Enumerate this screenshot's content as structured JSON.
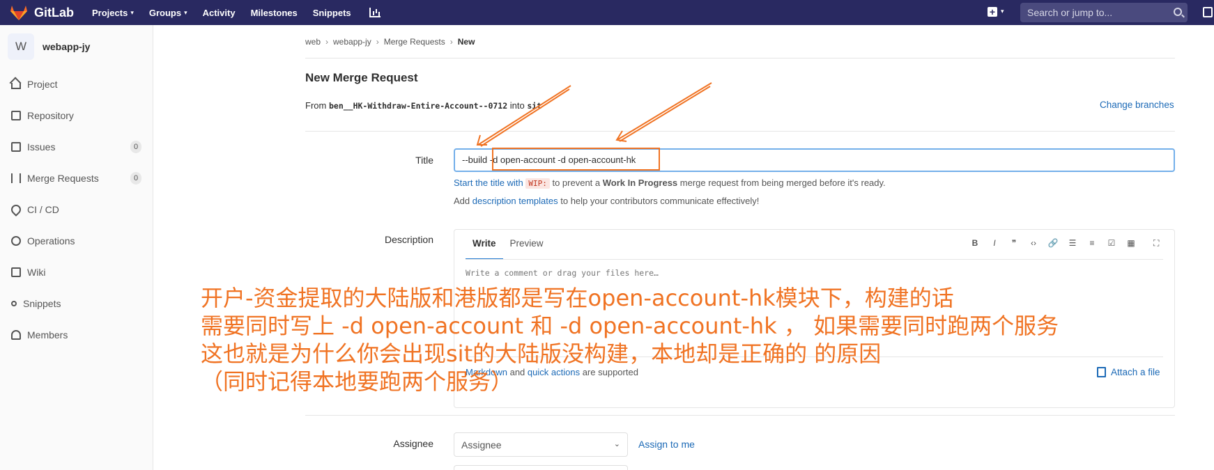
{
  "topbar": {
    "brand": "GitLab",
    "nav": [
      {
        "label": "Projects",
        "caret": "▾"
      },
      {
        "label": "Groups",
        "caret": "▾"
      },
      {
        "label": "Activity",
        "caret": ""
      },
      {
        "label": "Milestones",
        "caret": ""
      },
      {
        "label": "Snippets",
        "caret": ""
      }
    ],
    "search_placeholder": "Search or jump to...",
    "brand_color": "#292961",
    "logo_color": "#fc6d26"
  },
  "sidebar": {
    "avatar_letter": "W",
    "project_name": "webapp-jy",
    "items": [
      {
        "label": "Project",
        "icon": "home-icon"
      },
      {
        "label": "Repository",
        "icon": "book-icon"
      },
      {
        "label": "Issues",
        "icon": "issues-icon",
        "count": "0"
      },
      {
        "label": "Merge Requests",
        "icon": "git-merge-icon",
        "count": "0"
      },
      {
        "label": "CI / CD",
        "icon": "rocket-icon"
      },
      {
        "label": "Operations",
        "icon": "cloud-gear-icon"
      },
      {
        "label": "Wiki",
        "icon": "book-icon"
      },
      {
        "label": "Snippets",
        "icon": "scissors-icon"
      },
      {
        "label": "Members",
        "icon": "users-icon"
      }
    ]
  },
  "breadcrumb": [
    "web",
    "webapp-jy",
    "Merge Requests",
    "New"
  ],
  "main": {
    "title": "New Merge Request",
    "from_prefix": "From",
    "source_branch": "ben__HK-Withdraw-Entire-Account--0712",
    "into_word": "into",
    "target_branch": "sit",
    "change_branches": "Change branches",
    "title_label": "Title",
    "title_value": "--build -d open-account -d open-account-hk",
    "hint_start": "Start the title with",
    "hint_code": "WIP:",
    "hint_mid": "to prevent a",
    "hint_bold": "Work In Progress",
    "hint_end": "merge request from being merged before it's ready.",
    "hint2_pre": "Add",
    "hint2_link": "description templates",
    "hint2_post": "to help your contributors communicate effectively!",
    "description_label": "Description",
    "tab_write": "Write",
    "tab_preview": "Preview",
    "toolbar": [
      "B",
      "I",
      "❞",
      "‹›",
      "🔗",
      "☰",
      "≡",
      "☑",
      "▦"
    ],
    "fullscreen": "⛶",
    "placeholder": "Write a comment or drag your files here…",
    "md_link": "Markdown",
    "md_and": "and",
    "md_quick": "quick actions",
    "md_supported": "are supported",
    "attach": "Attach a file",
    "assignee_label": "Assignee",
    "assignee_value": "Assignee",
    "assign_me": "Assign to me"
  },
  "annotation": {
    "lines": [
      "开户-资金提取的大陆版和港版都是写在open-account-hk模块下，构建的话",
      "需要同时写上 -d open-account 和 -d open-account-hk ， 如果需要同时跑两个服务",
      "这也就是为什么你会出现sit的大陆版没构建，本地却是正确的 的原因",
      "（同时记得本地要跑两个服务）"
    ],
    "color": "#f07323"
  }
}
